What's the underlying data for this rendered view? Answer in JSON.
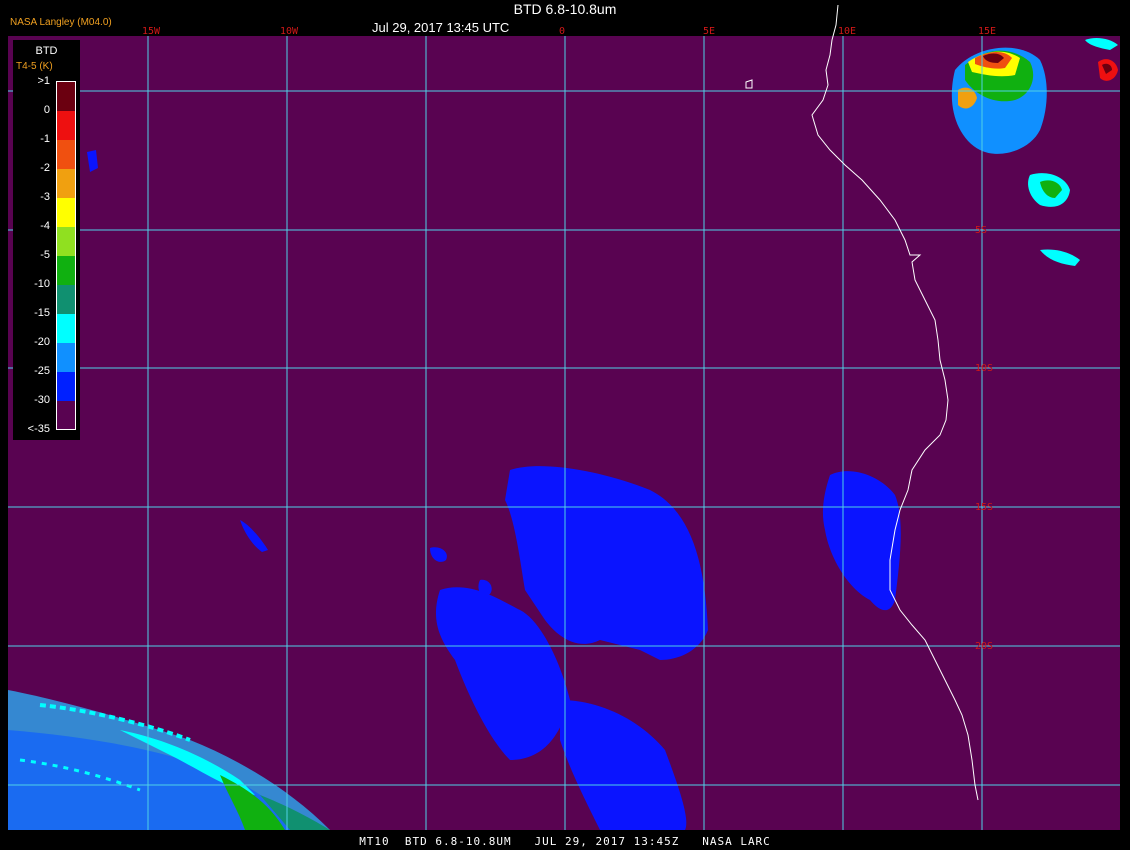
{
  "header": {
    "title": "BTD 6.8-10.8um",
    "subtitle": "Jul 29, 2017 13:45 UTC",
    "provider": "NASA Langley (M04.0)"
  },
  "legend": {
    "title": "BTD",
    "subtitle": "T4-5 (K)",
    "labels": [
      ">1",
      "0",
      "-1",
      "-2",
      "-3",
      "-4",
      "-5",
      "-10",
      "-15",
      "-20",
      "-25",
      "-30",
      "<-35"
    ],
    "colors": [
      "#6b0010",
      "#ee1010",
      "#f05010",
      "#f0a010",
      "#ffff00",
      "#90e020",
      "#10b010",
      "#109070",
      "#00ffff",
      "#1090ff",
      "#0020ff",
      "#590351"
    ]
  },
  "grid": {
    "lon_labels": [
      "15W",
      "10W",
      "0",
      "5E",
      "10E",
      "15E"
    ],
    "lat_labels": [
      "5S",
      "10S",
      "15S",
      "20S"
    ]
  },
  "colors": {
    "background": "#590351",
    "gridline": "#4fd2e6",
    "coastline": "#ffffff",
    "grid_label": "#d01818"
  },
  "footer": {
    "text": "MT10  BTD 6.8-10.8UM   JUL 29, 2017 13:45Z   NASA LARC"
  }
}
